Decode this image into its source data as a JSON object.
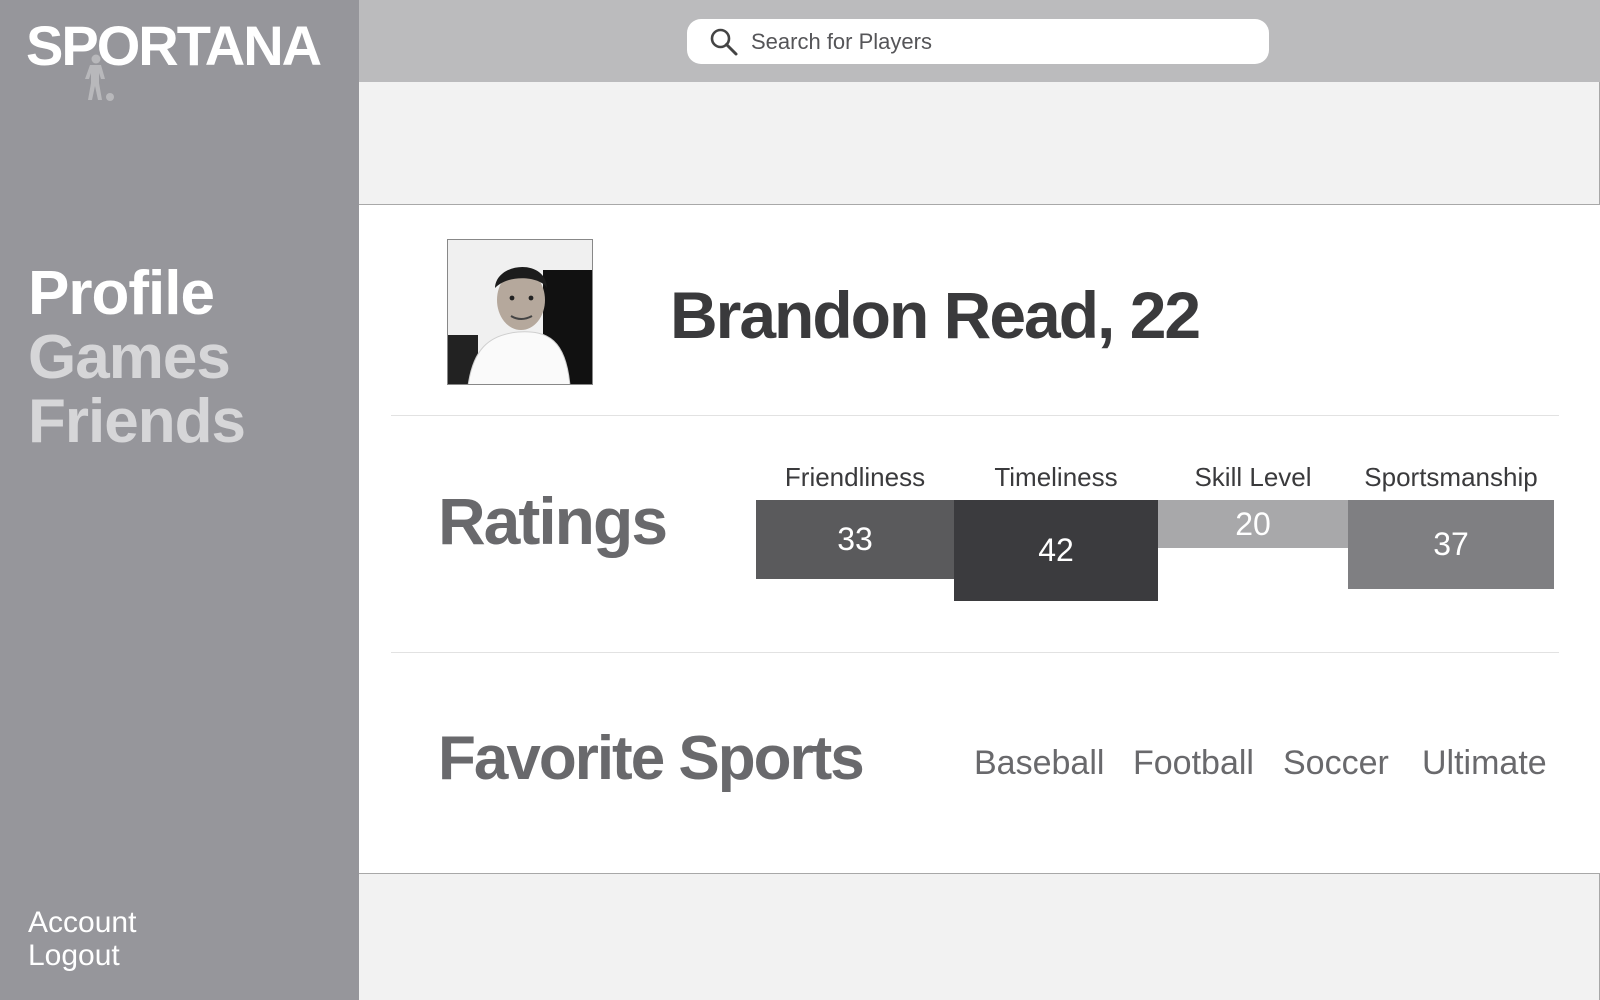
{
  "app": {
    "logo_text": "SPORTANA"
  },
  "search": {
    "placeholder": "Search for Players"
  },
  "sidebar": {
    "nav": [
      {
        "label": "Profile",
        "active": true
      },
      {
        "label": "Games",
        "active": false
      },
      {
        "label": "Friends",
        "active": false
      }
    ],
    "account": [
      {
        "label": "Account"
      },
      {
        "label": "Logout"
      }
    ]
  },
  "profile": {
    "name_age": "Brandon Read, 22",
    "avatar_icon": "profile-photo"
  },
  "ratings": {
    "title": "Ratings",
    "items": [
      {
        "label": "Friendliness",
        "value": "33",
        "color": "#5a5a5c"
      },
      {
        "label": "Timeliness",
        "value": "42",
        "color": "#3b3b3e"
      },
      {
        "label": "Skill Level",
        "value": "20",
        "color": "#a8a8aa"
      },
      {
        "label": "Sportsmanship",
        "value": "37",
        "color": "#7f7f82"
      }
    ]
  },
  "favorite_sports": {
    "title": "Favorite Sports",
    "items": [
      {
        "label": "Baseball"
      },
      {
        "label": "Football"
      },
      {
        "label": "Soccer"
      },
      {
        "label": "Ultimate"
      }
    ]
  },
  "colors": {
    "sidebar_bg": "#96969b",
    "topbar_bg": "#bbbbbd",
    "band_bg": "#f2f2f2",
    "heading_text": "#69696c"
  }
}
